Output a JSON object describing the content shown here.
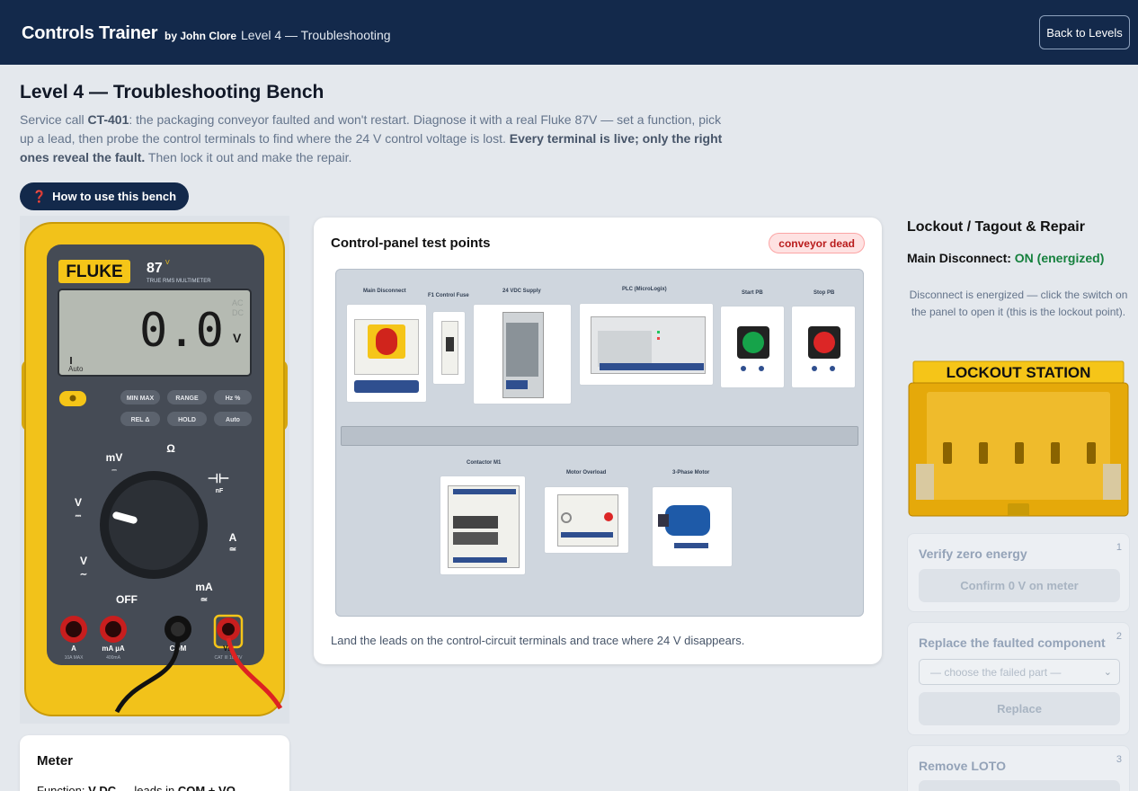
{
  "header": {
    "brand": "Controls Trainer",
    "byline": "by John Clore",
    "crumb": "Level 4 — Troubleshooting",
    "back_label": "Back to Levels"
  },
  "page": {
    "title": "Level 4 — Troubleshooting Bench",
    "intro_a": "Service call ",
    "intro_call": "CT-401",
    "intro_b": ": the packaging conveyor faulted and won't restart. Diagnose it with a real Fluke 87V — set a function, pick up a lead, then probe the control terminals to find where the 24 V control voltage is lost. ",
    "intro_bold": "Every terminal is live; only the right ones reveal the fault.",
    "intro_c": " Then lock it out and make the repair.",
    "how_label": "How to use this bench",
    "how_icon": "question-icon"
  },
  "meter": {
    "brand": "FLUKE",
    "model": "87",
    "model_sup": "V",
    "subtitle": "TRUE RMS MULTIMETER",
    "display_value": "0.0",
    "display_unit": "V",
    "display_ac": "AC",
    "display_dc": "DC",
    "display_auto": "Auto",
    "buttons": [
      "MIN MAX",
      "RANGE",
      "Hz %",
      "REL Δ",
      "HOLD",
      "Auto"
    ],
    "dial": {
      "mv": "mV",
      "ohm": "Ω",
      "cap": "nF",
      "vdc": "V",
      "a": "A",
      "vac": "V",
      "off": "OFF",
      "ma": "mA"
    },
    "jacks": {
      "a": "A",
      "a_sub": "10A MAX",
      "ma": "mA µA",
      "ma_sub": "400mA",
      "com": "COM",
      "vo": "VΩ",
      "vo_sub": "CAT III 1000V"
    }
  },
  "meter_card": {
    "title": "Meter",
    "function_label": "Function: ",
    "function_value": "V DC",
    "leads_label": " — leads in ",
    "leads_value": "COM + VΩ"
  },
  "panel": {
    "title": "Control-panel test points",
    "status": "conveyor dead",
    "footer": "Land the leads on the control-circuit terminals and trace where 24 V disappears.",
    "components": {
      "disconnect": "Main Disconnect",
      "fuse": "F1 Control Fuse",
      "supply": "24 VDC Supply",
      "plc": "PLC (MicroLogix)",
      "start": "Start PB",
      "stop": "Stop PB",
      "contactor": "Contactor M1",
      "overload": "Motor Overload",
      "motor": "3-Phase Motor"
    }
  },
  "loto": {
    "title": "Lockout / Tagout & Repair",
    "disconnect_label": "Main Disconnect: ",
    "disconnect_state": "ON (energized)",
    "hint": "Disconnect is energized — click the switch on the panel to open it (this is the lockout point).",
    "station_label": "LOCKOUT STATION",
    "steps": [
      {
        "title": "Verify zero energy",
        "num": "1",
        "button": "Confirm 0 V on meter"
      },
      {
        "title": "Replace the faulted component",
        "num": "2",
        "select": "— choose the failed part —",
        "button": "Replace"
      },
      {
        "title": "Remove LOTO",
        "num": "3"
      }
    ]
  },
  "colors": {
    "navy": "#13294b",
    "fluke_yellow": "#f5c518",
    "energized_green": "#15803d",
    "fault_red": "#b91c1c"
  }
}
